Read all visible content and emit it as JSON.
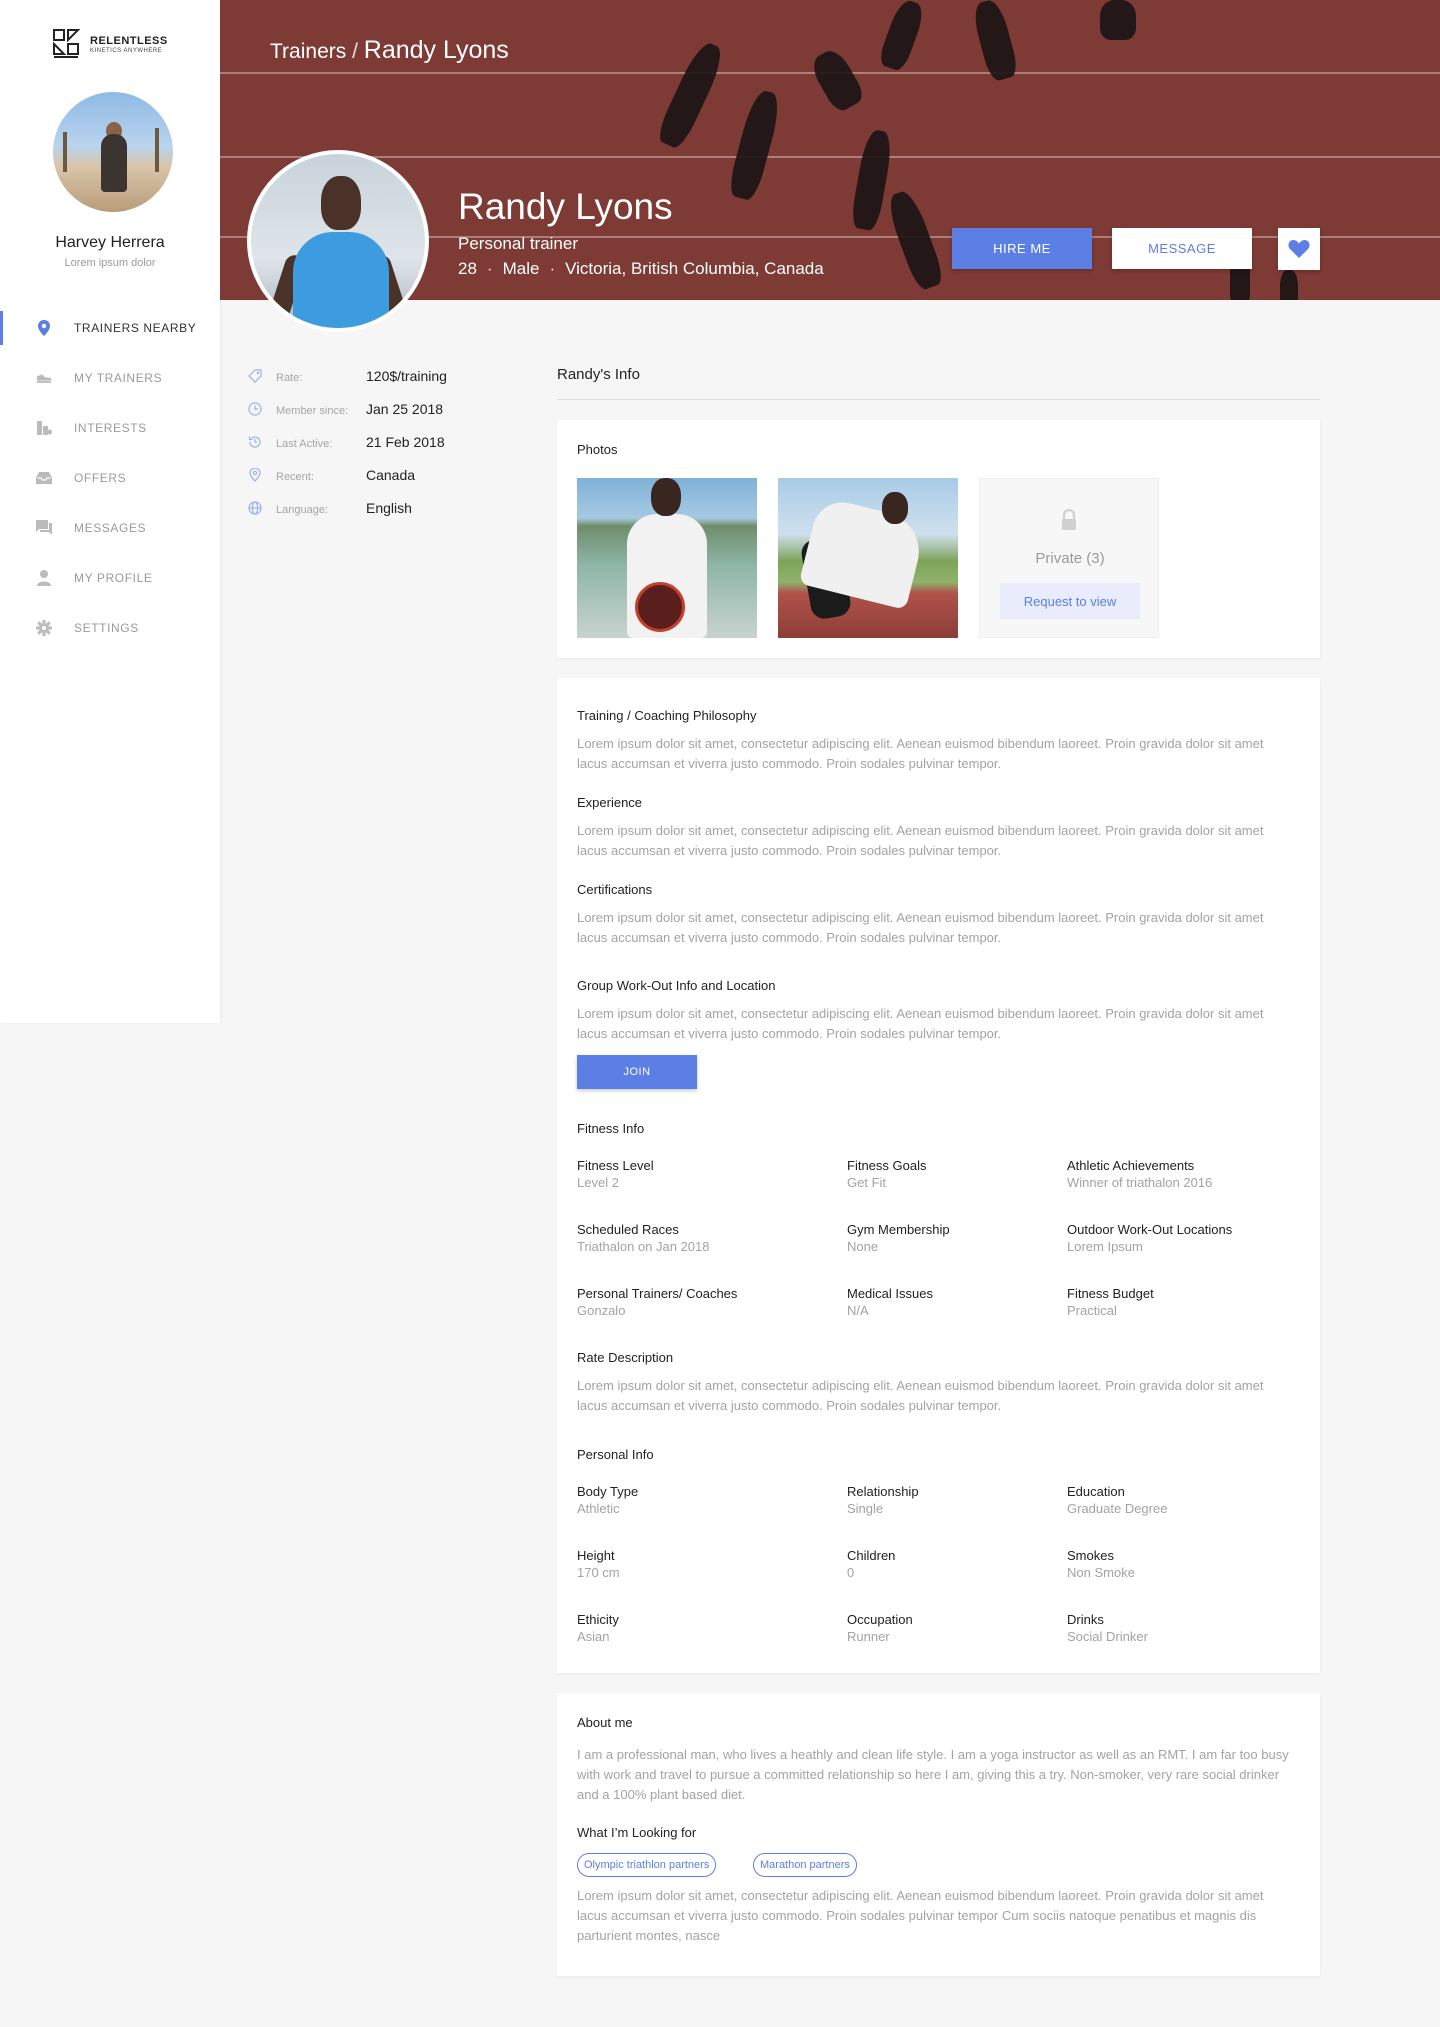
{
  "brand": {
    "name": "RELENTLESS",
    "tagline": "KINETICS ANYWHERE"
  },
  "user": {
    "name": "Harvey Herrera",
    "subtitle": "Lorem ipsum dolor"
  },
  "nav": [
    {
      "label": "TRAINERS NEARBY",
      "icon": "location-pin-icon",
      "active": true
    },
    {
      "label": "MY TRAINERS",
      "icon": "sneaker-icon",
      "active": false
    },
    {
      "label": "INTERESTS",
      "icon": "interests-icon",
      "active": false
    },
    {
      "label": "OFFERS",
      "icon": "inbox-icon",
      "active": false
    },
    {
      "label": "MESSAGES",
      "icon": "chat-icon",
      "active": false
    },
    {
      "label": "MY PROFILE",
      "icon": "person-icon",
      "active": false
    },
    {
      "label": "SETTINGS",
      "icon": "gear-icon",
      "active": false
    }
  ],
  "breadcrumb": {
    "parent": "Trainers",
    "separator": "/",
    "current": "Randy Lyons"
  },
  "profile": {
    "name": "Randy Lyons",
    "title": "Personal trainer",
    "age": "28",
    "gender": "Male",
    "location": "Victoria, British Columbia, Canada",
    "meta_separator": "·"
  },
  "actions": {
    "hire": "HIRE ME",
    "message": "MESSAGE",
    "favorite_icon": "heart-icon"
  },
  "details": [
    {
      "icon": "price-tag-icon",
      "label": "Rate:",
      "value": "120$/training"
    },
    {
      "icon": "clock-icon",
      "label": "Member since:",
      "value": "Jan 25 2018"
    },
    {
      "icon": "history-icon",
      "label": "Last Active:",
      "value": "21 Feb 2018"
    },
    {
      "icon": "map-pin-icon",
      "label": "Recent:",
      "value": "Canada"
    },
    {
      "icon": "globe-icon",
      "label": "Language:",
      "value": "English"
    }
  ],
  "info_heading": "Randy's Info",
  "photos": {
    "title": "Photos",
    "private_label": "Private (3)",
    "request_label": "Request to view"
  },
  "sections": {
    "philosophy": {
      "title": "Training / Coaching Philosophy",
      "text": "Lorem ipsum dolor sit amet, consectetur adipiscing elit. Aenean euismod bibendum laoreet. Proin gravida dolor sit amet lacus accumsan et viverra justo commodo. Proin sodales pulvinar tempor."
    },
    "experience": {
      "title": "Experience",
      "text": "Lorem ipsum dolor sit amet, consectetur adipiscing elit. Aenean euismod bibendum laoreet. Proin gravida dolor sit amet lacus accumsan et viverra justo commodo. Proin sodales pulvinar tempor."
    },
    "certifications": {
      "title": "Certifications",
      "text": "Lorem ipsum dolor sit amet, consectetur adipiscing elit. Aenean euismod bibendum laoreet. Proin gravida dolor sit amet lacus accumsan et viverra justo commodo. Proin sodales pulvinar tempor."
    },
    "group": {
      "title": "Group Work-Out Info and Location",
      "text": "Lorem ipsum dolor sit amet, consectetur adipiscing elit. Aenean euismod bibendum laoreet. Proin gravida dolor sit amet lacus accumsan et viverra justo commodo. Proin sodales pulvinar tempor.",
      "join_label": "JOIN"
    },
    "fitness_title": "Fitness Info",
    "fitness": [
      {
        "label": "Fitness Level",
        "value": "Level 2"
      },
      {
        "label": "Fitness Goals",
        "value": "Get Fit"
      },
      {
        "label": "Athletic Achievements",
        "value": "Winner of triathalon 2016"
      },
      {
        "label": "Scheduled Races",
        "value": "Triathalon on Jan 2018"
      },
      {
        "label": "Gym Membership",
        "value": "None"
      },
      {
        "label": "Outdoor Work-Out Locations",
        "value": "Lorem Ipsum"
      },
      {
        "label": "Personal Trainers/ Coaches",
        "value": "Gonzalo"
      },
      {
        "label": "Medical Issues",
        "value": "N/A"
      },
      {
        "label": "Fitness Budget",
        "value": "Practical"
      }
    ],
    "rate": {
      "title": "Rate Description",
      "text": "Lorem ipsum dolor sit amet, consectetur adipiscing elit. Aenean euismod bibendum laoreet. Proin gravida dolor sit amet lacus accumsan et viverra justo commodo. Proin sodales pulvinar tempor."
    },
    "personal_title": "Personal Info",
    "personal": [
      {
        "label": "Body Type",
        "value": "Athletic"
      },
      {
        "label": "Relationship",
        "value": "Single"
      },
      {
        "label": "Education",
        "value": "Graduate Degree"
      },
      {
        "label": "Height",
        "value": "170 cm"
      },
      {
        "label": "Children",
        "value": "0"
      },
      {
        "label": "Smokes",
        "value": "Non Smoke"
      },
      {
        "label": "Ethicity",
        "value": "Asian"
      },
      {
        "label": "Occupation",
        "value": "Runner"
      },
      {
        "label": "Drinks",
        "value": "Social Drinker"
      }
    ]
  },
  "about": {
    "title": "About me",
    "text": "I am a professional man, who lives a heathly and clean life style. I am a yoga instructor as well as an RMT. I am far too busy with work and travel to pursue a committed relationship so here I am, giving this a try.  Non-smoker, very rare social drinker and a 100% plant based diet.",
    "looking_title": "What I’m Looking for",
    "chips": [
      "Olympic triathlon partners",
      "Marathon partners"
    ],
    "looking_text": "Lorem ipsum dolor sit amet, consectetur adipiscing elit. Aenean euismod bibendum laoreet. Proin gravida dolor sit amet lacus accumsan et viverra justo commodo. Proin sodales pulvinar tempor Cum sociis natoque penatibus et magnis dis parturient montes, nasce"
  },
  "colors": {
    "accent": "#5c7fe6",
    "hero": "#7e3a34",
    "muted": "#a3a3a3"
  }
}
